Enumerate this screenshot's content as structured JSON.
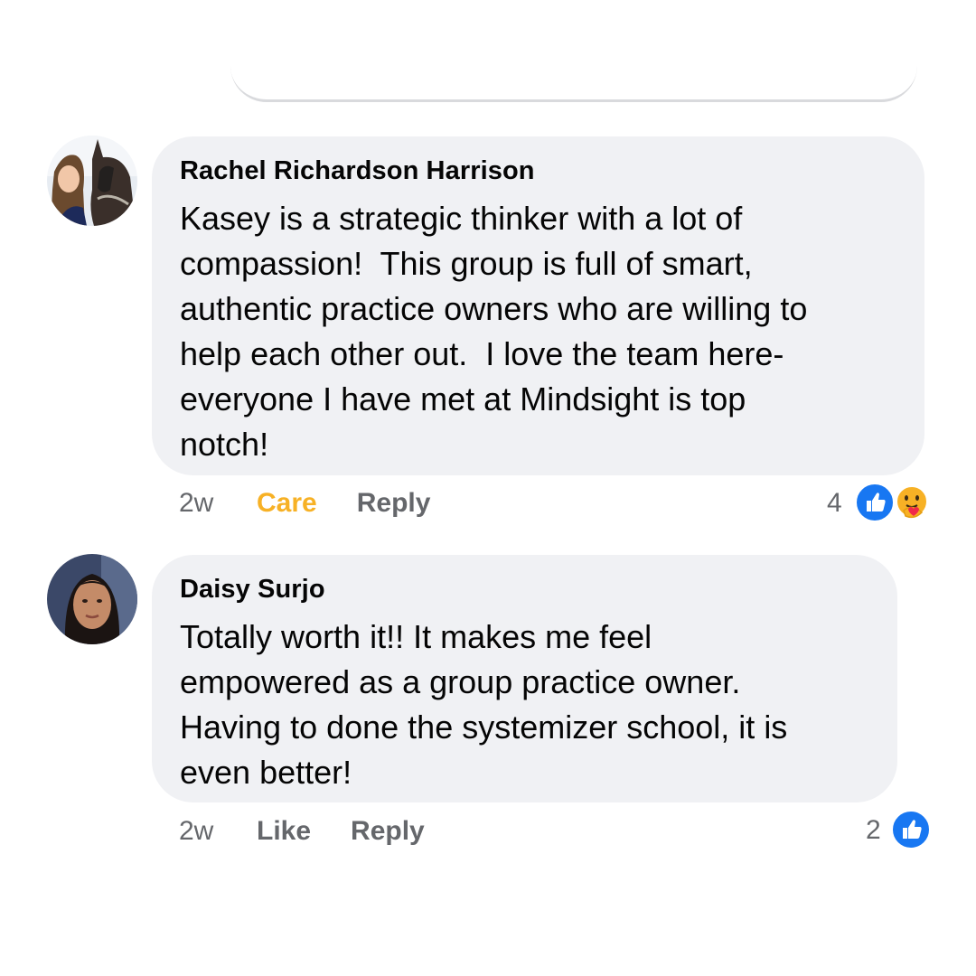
{
  "comments": [
    {
      "author": "Rachel Richardson Harrison",
      "text": "Kasey is a strategic thinker with a lot of\ncompassion!  This group is full of smart,\nauthentic practice owners who are willing to\nhelp each other out.  I love the team here-\neveryone I have met at Mindsight is top\nnotch!",
      "time": "2w",
      "reaction_label": "Care",
      "reply_label": "Reply",
      "reaction_count": "4",
      "reaction_icons": [
        "like-icon",
        "care-icon"
      ],
      "reaction_color": "#f7b125"
    },
    {
      "author": "Daisy Surjo",
      "text": "Totally worth it!! It makes me feel\nempowered as a group practice owner.\nHaving to done the systemizer school, it is\neven better!",
      "time": "2w",
      "reaction_label": "Like",
      "reply_label": "Reply",
      "reaction_count": "2",
      "reaction_icons": [
        "like-icon"
      ]
    }
  ],
  "colors": {
    "bubble": "#f0f1f4",
    "meta": "#65676b",
    "like_blue": "#1877f2",
    "care_yellow": "#f7b125"
  }
}
